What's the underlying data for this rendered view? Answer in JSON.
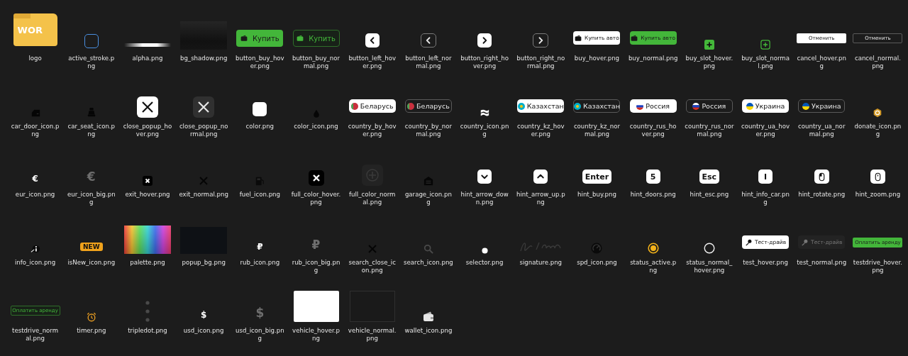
{
  "files": [
    {
      "label": "logo",
      "kind": "folder",
      "text": "WOR"
    },
    {
      "label": "active_stroke.png",
      "kind": "swatch"
    },
    {
      "label": "alpha.png",
      "kind": "swatch"
    },
    {
      "label": "bg_shadow.png",
      "kind": "swatch"
    },
    {
      "label": "button_buy_hover.png",
      "kind": "button",
      "text": "Купить"
    },
    {
      "label": "button_buy_normal.png",
      "kind": "button",
      "text": "Купить"
    },
    {
      "label": "button_left_hover.png",
      "kind": "key"
    },
    {
      "label": "button_left_normal.png",
      "kind": "key"
    },
    {
      "label": "button_right_hover.png",
      "kind": "key"
    },
    {
      "label": "button_right_normal.png",
      "kind": "key"
    },
    {
      "label": "buy_hover.png",
      "kind": "button",
      "text": "Купить авто"
    },
    {
      "label": "buy_normal.png",
      "kind": "button",
      "text": "Купить авто"
    },
    {
      "label": "buy_slot_hover.png",
      "kind": "icon"
    },
    {
      "label": "buy_slot_normal.png",
      "kind": "icon"
    },
    {
      "label": "cancel_hover.png",
      "kind": "button",
      "text": "Отменить"
    },
    {
      "label": "cancel_normal.png",
      "kind": "button",
      "text": "Отменить"
    },
    {
      "label": "car_door_icon.png",
      "kind": "icon"
    },
    {
      "label": "car_seat_icon.png",
      "kind": "icon"
    },
    {
      "label": "close_popup_hover.png",
      "kind": "icon"
    },
    {
      "label": "close_popup_normal.png",
      "kind": "icon"
    },
    {
      "label": "color.png",
      "kind": "swatch"
    },
    {
      "label": "color_icon.png",
      "kind": "icon"
    },
    {
      "label": "country_by_hover.png",
      "kind": "button",
      "text": "Беларусь"
    },
    {
      "label": "country_by_normal.png",
      "kind": "button",
      "text": "Беларусь"
    },
    {
      "label": "country_icon.png",
      "kind": "icon"
    },
    {
      "label": "country_kz_hover.png",
      "kind": "button",
      "text": "Казахстан"
    },
    {
      "label": "country_kz_normal.png",
      "kind": "button",
      "text": "Казахстан"
    },
    {
      "label": "country_rus_hover.png",
      "kind": "button",
      "text": "Россия"
    },
    {
      "label": "country_rus_normal.png",
      "kind": "button",
      "text": "Россия"
    },
    {
      "label": "country_ua_hover.png",
      "kind": "button",
      "text": "Украина"
    },
    {
      "label": "country_ua_normal.png",
      "kind": "button",
      "text": "Украина"
    },
    {
      "label": "donate_icon.png",
      "kind": "icon"
    },
    {
      "label": "eur_icon.png",
      "kind": "glyph",
      "text": "€"
    },
    {
      "label": "eur_icon_big.png",
      "kind": "glyph",
      "text": "€"
    },
    {
      "label": "exit_hover.png",
      "kind": "icon"
    },
    {
      "label": "exit_normal.png",
      "kind": "icon"
    },
    {
      "label": "fuel_icon.png",
      "kind": "icon"
    },
    {
      "label": "full_color_hover.png",
      "kind": "icon"
    },
    {
      "label": "full_color_normal.png",
      "kind": "icon"
    },
    {
      "label": "garage_icon.png",
      "kind": "icon"
    },
    {
      "label": "hint_arrow_down.png",
      "kind": "key"
    },
    {
      "label": "hint_arrow_up.png",
      "kind": "key"
    },
    {
      "label": "hint_buy.png",
      "kind": "key",
      "text": "Enter"
    },
    {
      "label": "hint_doors.png",
      "kind": "key",
      "text": "5"
    },
    {
      "label": "hint_esc.png",
      "kind": "key",
      "text": "Esc"
    },
    {
      "label": "hint_info_car.png",
      "kind": "key",
      "text": "I"
    },
    {
      "label": "hint_rotate.png",
      "kind": "key"
    },
    {
      "label": "hint_zoom.png",
      "kind": "key"
    },
    {
      "label": "info_icon.png",
      "kind": "icon"
    },
    {
      "label": "isNew_icon.png",
      "kind": "badge",
      "text": "NEW"
    },
    {
      "label": "palette.png",
      "kind": "swatch"
    },
    {
      "label": "popup_bg.png",
      "kind": "swatch"
    },
    {
      "label": "rub_icon.png",
      "kind": "glyph",
      "text": "₽"
    },
    {
      "label": "rub_icon_big.png",
      "kind": "glyph",
      "text": "₽"
    },
    {
      "label": "search_close_icon.png",
      "kind": "icon"
    },
    {
      "label": "search_icon.png",
      "kind": "icon"
    },
    {
      "label": "selector.png",
      "kind": "icon"
    },
    {
      "label": "signature.png",
      "kind": "icon"
    },
    {
      "label": "spd_icon.png",
      "kind": "icon"
    },
    {
      "label": "status_active.png",
      "kind": "icon"
    },
    {
      "label": "status_normal_hover.png",
      "kind": "icon"
    },
    {
      "label": "test_hover.png",
      "kind": "button",
      "text": "Тест-драйв"
    },
    {
      "label": "test_normal.png",
      "kind": "button",
      "text": "Тест-драйв"
    },
    {
      "label": "testdrive_hover.png",
      "kind": "button",
      "text": "Оплатить аренду"
    },
    {
      "label": "testdrive_normal.png",
      "kind": "button",
      "text": "Оплатить аренду"
    },
    {
      "label": "timer.png",
      "kind": "icon"
    },
    {
      "label": "tripledot.png",
      "kind": "icon"
    },
    {
      "label": "usd_icon.png",
      "kind": "glyph",
      "text": "$"
    },
    {
      "label": "usd_icon_big.png",
      "kind": "glyph",
      "text": "$"
    },
    {
      "label": "vehicle_hover.png",
      "kind": "swatch"
    },
    {
      "label": "vehicle_normal.png",
      "kind": "swatch"
    },
    {
      "label": "wallet_icon.png",
      "kind": "icon"
    }
  ]
}
